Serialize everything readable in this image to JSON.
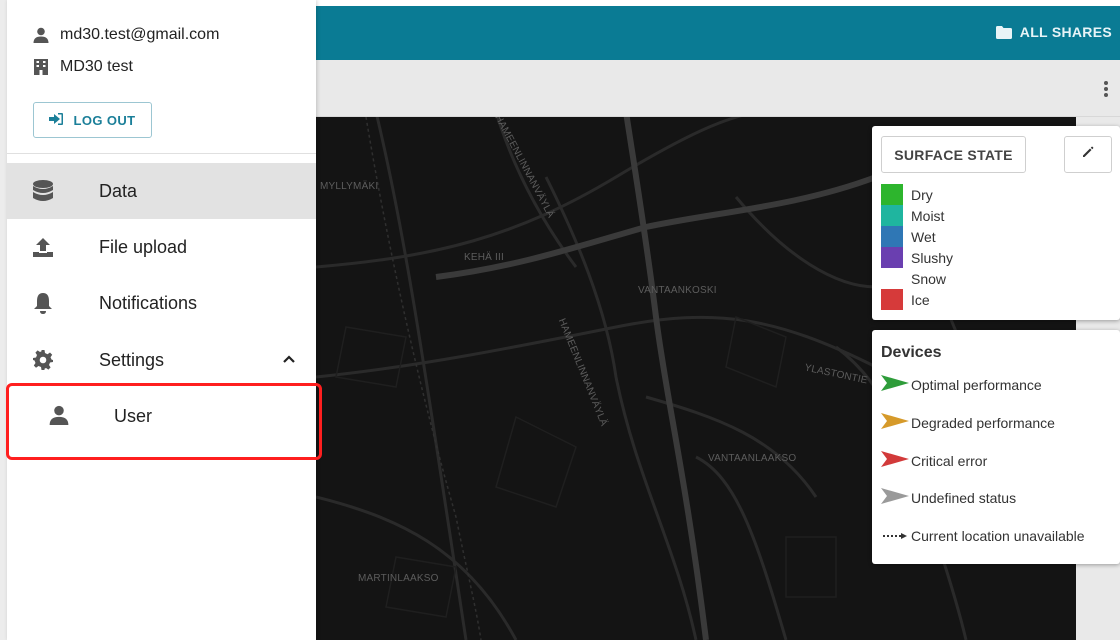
{
  "topbar": {
    "shares_label": "ALL SHARES",
    "shares_icon": "folder-icon",
    "color": "#0a7b94"
  },
  "drawer": {
    "user": {
      "email": "md30.test@gmail.com",
      "email_icon": "person-icon",
      "organization": "MD30 test",
      "organization_icon": "building-icon"
    },
    "logout_label": "LOG OUT",
    "nav": [
      {
        "label": "Data",
        "icon": "database-icon",
        "active": true
      },
      {
        "label": "File upload",
        "icon": "upload-icon",
        "active": false
      },
      {
        "label": "Notifications",
        "icon": "bell-icon",
        "active": false
      },
      {
        "label": "Settings",
        "icon": "gear-icon",
        "active": false,
        "expanded": true
      }
    ],
    "settings_sub": [
      {
        "label": "User",
        "icon": "person-icon"
      }
    ]
  },
  "map": {
    "labels": [
      "MYLLYMÄKI",
      "KEHÄ III",
      "VANTAANKOSKI",
      "HAMEENLINNANVÄYLÄ",
      "VANTAANLAAKSO",
      "YLASTONTIE",
      "MARTINLAAKSO",
      "HAMEENLINNANVÄYLÄ"
    ]
  },
  "surface_legend": {
    "button_label": "SURFACE STATE",
    "states": [
      {
        "label": "Dry",
        "color": "#2db52d"
      },
      {
        "label": "Moist",
        "color": "#1fb59f"
      },
      {
        "label": "Wet",
        "color": "#2f77b5"
      },
      {
        "label": "Slushy",
        "color": "#6a3fb0"
      },
      {
        "label": "Snow",
        "color": "#ffffff"
      },
      {
        "label": "Ice",
        "color": "#d63a3a"
      }
    ]
  },
  "devices_legend": {
    "title": "Devices",
    "items": [
      {
        "label": "Optimal performance",
        "color": "#2e9c3a"
      },
      {
        "label": "Degraded performance",
        "color": "#d69a2a"
      },
      {
        "label": "Critical error",
        "color": "#d23a3a"
      },
      {
        "label": "Undefined status",
        "color": "#9a9a9a"
      },
      {
        "label": "Current location unavailable",
        "color": "#333333"
      }
    ]
  },
  "highlight_color": "#ff1f1f"
}
